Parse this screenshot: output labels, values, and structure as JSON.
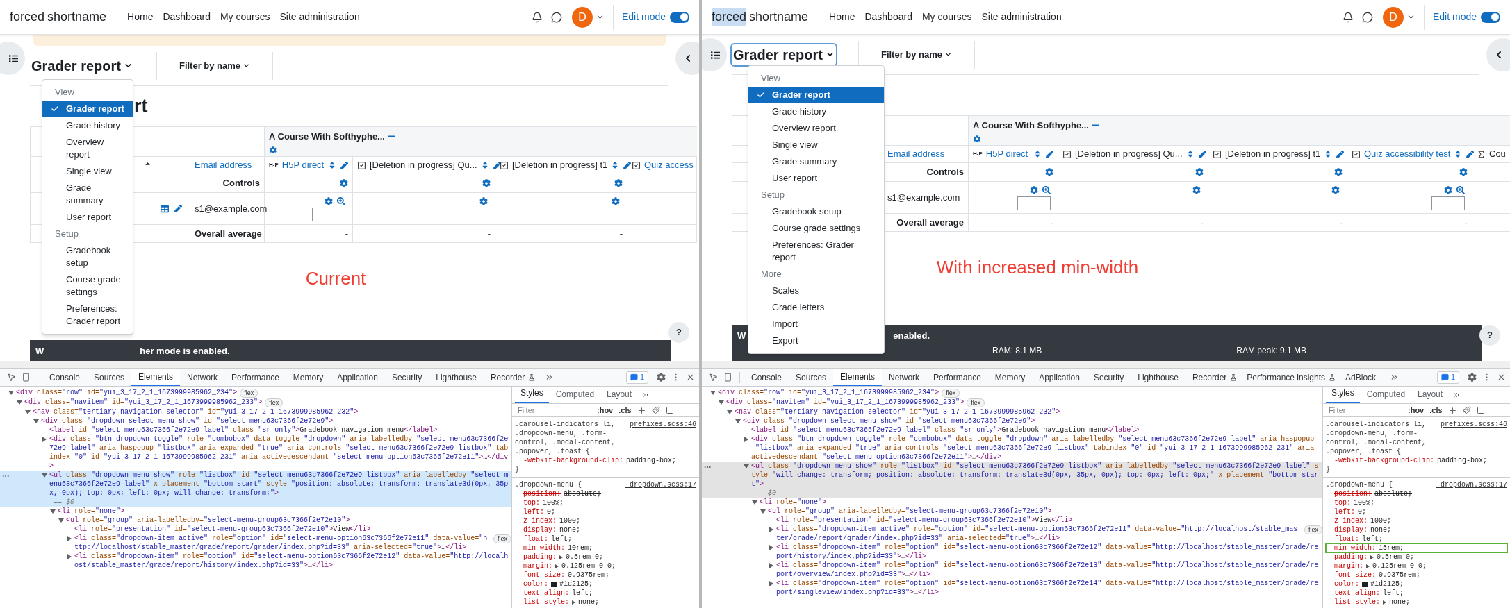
{
  "panes": [
    {
      "navbar": {
        "site_name": [
          {
            "text": "forced",
            "highlighted": false
          },
          {
            "text": "shortname",
            "highlighted": false
          }
        ],
        "links": [
          "Home",
          "Dashboard",
          "My courses",
          "Site administration"
        ],
        "avatar": "D",
        "edit_mode": {
          "label": "Edit mode",
          "on": true
        }
      },
      "alert_bar": true,
      "report_selector": {
        "label": "Grader report",
        "focused": false
      },
      "filter": "Filter by name",
      "heading": "rt",
      "menu": {
        "groups": [
          {
            "heading": "View",
            "items": [
              {
                "label": "Grader report",
                "selected": true
              },
              {
                "label": "Grade history",
                "selected": false
              },
              {
                "label": "Overview report",
                "selected": false
              },
              {
                "label": "Single view",
                "selected": false
              },
              {
                "label": "Grade summary",
                "selected": false
              },
              {
                "label": "User report",
                "selected": false
              }
            ]
          },
          {
            "heading": "Setup",
            "items": [
              {
                "label": "Gradebook setup",
                "selected": false
              },
              {
                "label": "Course grade settings",
                "selected": false
              },
              {
                "label": "Preferences: Grader report",
                "selected": false
              }
            ]
          }
        ]
      },
      "table": {
        "course": "A Course With Softhyphe...",
        "columns": [
          {
            "kind": "sort"
          },
          {
            "kind": "user_actions"
          },
          {
            "kind": "email",
            "header": "Email address",
            "controls": "Controls",
            "student": "s1@example.com",
            "average": "Overall average"
          },
          {
            "kind": "h5p",
            "logo": "H-P",
            "header": "H5P direct",
            "link": true,
            "tools": true,
            "controls_gear": true,
            "student_gear": true,
            "student_entry": true,
            "average": "-"
          },
          {
            "kind": "check",
            "header": "[Deletion in progress] Qu...",
            "link": false,
            "tools": true,
            "controls_gear": true,
            "student_gear": true,
            "student_entry": false,
            "average": "-"
          },
          {
            "kind": "check",
            "header": "[Deletion in progress] t1",
            "link": false,
            "tools": true,
            "controls_gear": true,
            "student_gear": true,
            "student_entry": false,
            "average": "-"
          },
          {
            "kind": "check",
            "header": "Quiz access",
            "link": true,
            "tools": false,
            "controls_gear": false,
            "student_gear": false,
            "student_entry": false
          }
        ]
      },
      "caption": "Current",
      "notice": [
        "W",
        "her mode is enabled."
      ],
      "help": "?",
      "devtools": {
        "focused": true,
        "tabs": [
          {
            "label": "Console",
            "selected": false
          },
          {
            "label": "Sources",
            "selected": false
          },
          {
            "label": "Elements",
            "selected": true
          },
          {
            "label": "Network",
            "selected": false
          },
          {
            "label": "Performance",
            "selected": false
          },
          {
            "label": "Memory",
            "selected": false
          },
          {
            "label": "Application",
            "selected": false
          },
          {
            "label": "Security",
            "selected": false
          },
          {
            "label": "Lighthouse",
            "selected": false
          },
          {
            "label": "Recorder",
            "selected": false,
            "flask": true
          }
        ],
        "issues": "1",
        "tree": [
          {
            "html": "<div class=\"row\" id=\"yui_3_17_2_1_1673999985962_234\">",
            "badge": "flex",
            "expanded": true,
            "selected": false,
            "children": [
              {
                "html": "<div class=\"navitem\" id=\"yui_3_17_2_1_1673999985962_233\">",
                "badge": "flex",
                "expanded": true,
                "selected": false,
                "children": [
                  {
                    "html": "<nav class=\"tertiary-navigation-selector\" id=\"yui_3_17_2_1_1673999985962_232\">",
                    "expanded": true,
                    "selected": false,
                    "children": [
                      {
                        "html": "<div class=\"dropdown select-menu show\" id=\"select-menu63c7366f2e72e9\">",
                        "expanded": true,
                        "selected": false,
                        "children": [
                          {
                            "html": "<label id=\"select-menu63c7366f2e72e9-label\" class=\"sr-only\">Gradebook navigation menu</label>",
                            "selected": false
                          },
                          {
                            "html": "<div class=\"btn dropdown-toggle\" role=\"combobox\" data-toggle=\"dropdown\" aria-labelledby=\"select-menu63c7366f2e72e9-label\" aria-haspopup=\"listbox\" aria-expanded=\"true\" aria-controls=\"select-menu63c7366f2e72e9-listbox\" tabindex=\"0\" id=\"yui_3_17_2_1_1673999985962_231\" aria-activedescendant=\"select-menu-option63c7366f2e72e11\">…</div>",
                            "expanded": false,
                            "selected": false
                          },
                          {
                            "html": "<ul class=\"dropdown-menu show\" role=\"listbox\" id=\"select-menu63c7366f2e72e9-listbox\" aria-labelledby=\"select-menu63c7366f2e72e9-label\" x-placement=\"bottom-start\" style=\"position: absolute; transform: translate3d(0px, 35px, 0px); top: 0px; left: 0px; will-change: transform;\">",
                            "marker": "== $0",
                            "expanded": true,
                            "selected": true,
                            "children": [
                              {
                                "html": "<li role=\"none\">",
                                "expanded": true,
                                "selected": false,
                                "children": [
                                  {
                                    "html": "<ul role=\"group\" aria-labelledby=\"select-menu-group63c7366f2e72e10\">",
                                    "expanded": true,
                                    "selected": false,
                                    "children": [
                                      {
                                        "html": "<li role=\"presentation\" id=\"select-menu-group63c7366f2e72e10\">View</li>",
                                        "selected": false
                                      },
                                      {
                                        "html": "<li class=\"dropdown-item active\" role=\"option\" id=\"select-menu-option63c7366f2e72e11\" data-value=\"http://localhost/stable_master/grade/report/grader/index.php?id=33\" aria-selected=\"true\">…</li>",
                                        "badge": "flex",
                                        "expanded": false,
                                        "selected": false
                                      },
                                      {
                                        "html": "<li class=\"dropdown-item\" role=\"option\" id=\"select-menu-option63c7366f2e72e12\" data-value=\"http://localhost/stable_master/grade/report/history/index.php?id=33\">…</li>",
                                        "expanded": false,
                                        "selected": false
                                      }
                                    ]
                                  }
                                ]
                              }
                            ]
                          }
                        ]
                      }
                    ]
                  }
                ]
              }
            ]
          }
        ],
        "styles": {
          "tabs": [
            {
              "label": "Styles",
              "selected": true
            },
            {
              "label": "Computed",
              "selected": false
            },
            {
              "label": "Layout",
              "selected": false
            }
          ],
          "filter_placeholder": "Filter",
          "hov": ":hov",
          "cls": ".cls",
          "rules": [
            {
              "selector": ".carousel-indicators li, .dropdown-menu, .form-control, .modal-content, .popover, .toast {",
              "source": "prefixes.scss:46",
              "close": "}",
              "declarations": [
                {
                  "property": "-webkit-background-clip:",
                  "value": "padding-box;",
                  "struck": false
                }
              ]
            },
            {
              "selector": ".dropdown-menu {",
              "source": "_dropdown.scss:17",
              "declarations": [
                {
                  "property": "position:",
                  "value": "absolute;",
                  "struck": true
                },
                {
                  "property": "top:",
                  "value": "100%;",
                  "struck": true
                },
                {
                  "property": "left:",
                  "value": "0;",
                  "struck": true
                },
                {
                  "property": "z-index:",
                  "value": "1000;",
                  "struck": false
                },
                {
                  "property": "display:",
                  "value": "none;",
                  "struck": true
                },
                {
                  "property": "float:",
                  "value": "left;",
                  "struck": false
                },
                {
                  "property": "min-width:",
                  "value": "10rem;",
                  "struck": false
                },
                {
                  "property": "padding:",
                  "value": "0.5rem 0;",
                  "struck": false,
                  "expandable": true
                },
                {
                  "property": "margin:",
                  "value": "0.125rem 0 0;",
                  "struck": false,
                  "expandable": true
                },
                {
                  "property": "font-size:",
                  "value": "0.9375rem;",
                  "struck": false
                },
                {
                  "property": "color:",
                  "value": "#1d2125;",
                  "struck": false,
                  "color": "#1d2125"
                },
                {
                  "property": "text-align:",
                  "value": "left;",
                  "struck": false
                },
                {
                  "property": "list-style:",
                  "value": "none;",
                  "struck": false,
                  "expandable": true
                }
              ]
            }
          ]
        }
      }
    },
    {
      "navbar": {
        "site_name": [
          {
            "text": "forced",
            "highlighted": true
          },
          {
            "text": "shortname",
            "highlighted": false
          }
        ],
        "links": [
          "Home",
          "Dashboard",
          "My courses",
          "Site administration"
        ],
        "avatar": "D",
        "edit_mode": {
          "label": "Edit mode",
          "on": true
        }
      },
      "alert_bar": false,
      "report_selector": {
        "label": "Grader report",
        "focused": true
      },
      "filter": "Filter by name",
      "menu": {
        "groups": [
          {
            "heading": "View",
            "items": [
              {
                "label": "Grader report",
                "selected": true
              },
              {
                "label": "Grade history",
                "selected": false
              },
              {
                "label": "Overview report",
                "selected": false
              },
              {
                "label": "Single view",
                "selected": false
              },
              {
                "label": "Grade summary",
                "selected": false
              },
              {
                "label": "User report",
                "selected": false
              }
            ]
          },
          {
            "heading": "Setup",
            "items": [
              {
                "label": "Gradebook setup",
                "selected": false
              },
              {
                "label": "Course grade settings",
                "selected": false
              },
              {
                "label": "Preferences: Grader report",
                "selected": false
              }
            ]
          },
          {
            "heading": "More",
            "items": [
              {
                "label": "Scales",
                "selected": false
              },
              {
                "label": "Grade letters",
                "selected": false
              },
              {
                "label": "Import",
                "selected": false
              },
              {
                "label": "Export",
                "selected": false
              }
            ]
          }
        ]
      },
      "table": {
        "course": "A Course With Softhyphe...",
        "columns": [
          {
            "kind": "spacer"
          },
          {
            "kind": "email",
            "header": "Email address",
            "controls": "Controls",
            "student": "s1@example.com",
            "average": "Overall average"
          },
          {
            "kind": "h5p",
            "logo": "H-P",
            "header": "H5P direct",
            "link": true,
            "tools": true,
            "controls_gear": true,
            "student_gear": true,
            "student_entry": true,
            "average": "-"
          },
          {
            "kind": "check",
            "header": "[Deletion in progress] Qu...",
            "link": false,
            "tools": true,
            "controls_gear": true,
            "student_gear": true,
            "student_entry": false,
            "average": "-"
          },
          {
            "kind": "check",
            "header": "[Deletion in progress] t1",
            "link": false,
            "tools": true,
            "controls_gear": true,
            "student_gear": true,
            "student_entry": false,
            "average": "-"
          },
          {
            "kind": "check",
            "header": "Quiz accessibility test",
            "link": true,
            "tools": true,
            "controls_gear": true,
            "student_gear": true,
            "student_entry": true,
            "average": "-"
          },
          {
            "kind": "sigma",
            "header": "Cou",
            "link": false,
            "tools": false,
            "controls_gear": false,
            "student_gear": false,
            "student_entry": false
          }
        ]
      },
      "caption": "With increased min-width",
      "notice": [
        "W",
        "enabled."
      ],
      "footer": [
        "RAM: 8.1 MB",
        "RAM peak: 9.1 MB"
      ],
      "help": "?",
      "devtools": {
        "focused": false,
        "tabs": [
          {
            "label": "Console",
            "selected": false
          },
          {
            "label": "Sources",
            "selected": false
          },
          {
            "label": "Elements",
            "selected": true
          },
          {
            "label": "Network",
            "selected": false
          },
          {
            "label": "Performance",
            "selected": false
          },
          {
            "label": "Memory",
            "selected": false
          },
          {
            "label": "Application",
            "selected": false
          },
          {
            "label": "Security",
            "selected": false
          },
          {
            "label": "Lighthouse",
            "selected": false
          },
          {
            "label": "Recorder",
            "selected": false,
            "flask": true
          },
          {
            "label": "Performance insights",
            "selected": false,
            "flask": true
          },
          {
            "label": "AdBlock",
            "selected": false
          }
        ],
        "issues": "1",
        "tree": [
          {
            "html": "<div class=\"row\" id=\"yui_3_17_2_1_1673999985962_234\">",
            "badge": "flex",
            "expanded": true,
            "selected": false,
            "children": [
              {
                "html": "<div class=\"navitem\" id=\"yui_3_17_2_1_1673999985962_233\">",
                "badge": "flex",
                "expanded": true,
                "selected": false,
                "children": [
                  {
                    "html": "<nav class=\"tertiary-navigation-selector\" id=\"yui_3_17_2_1_1673999985962_232\">",
                    "expanded": true,
                    "selected": false,
                    "children": [
                      {
                        "html": "<div class=\"dropdown select-menu show\" id=\"select-menu63c7366f2e72e9\">",
                        "expanded": true,
                        "selected": false,
                        "children": [
                          {
                            "html": "<label id=\"select-menu63c7366f2e72e9-label\" class=\"sr-only\">Gradebook navigation menu</label>",
                            "selected": false
                          },
                          {
                            "html": "<div class=\"btn dropdown-toggle\" role=\"combobox\" data-toggle=\"dropdown\" aria-labelledby=\"select-menu63c7366f2e72e9-label\" aria-haspopup=\"listbox\" aria-expanded=\"true\" aria-controls=\"select-menu63c7366f2e72e9-listbox\" tabindex=\"0\" id=\"yui_3_17_2_1_1673999985962_231\" aria-activedescendant=\"select-menu-option63c7366f2e72e11\">…</div>",
                            "expanded": false,
                            "selected": false
                          },
                          {
                            "html": "<ul class=\"dropdown-menu show\" role=\"listbox\" id=\"select-menu63c7366f2e72e9-listbox\" aria-labelledby=\"select-menu63c7366f2e72e9-label\" style=\"will-change: transform; position: absolute; transform: translate3d(0px, 35px, 0px); top: 0px; left: 0px;\" x-placement=\"bottom-start\">",
                            "marker": "== $0",
                            "expanded": true,
                            "selected": true,
                            "children": [
                              {
                                "html": "<li role=\"none\">",
                                "expanded": true,
                                "selected": false,
                                "children": [
                                  {
                                    "html": "<ul role=\"group\" aria-labelledby=\"select-menu-group63c7366f2e72e10\">",
                                    "expanded": true,
                                    "selected": false,
                                    "children": [
                                      {
                                        "html": "<li role=\"presentation\" id=\"select-menu-group63c7366f2e72e10\">View</li>",
                                        "selected": false
                                      },
                                      {
                                        "html": "<li class=\"dropdown-item active\" role=\"option\" id=\"select-menu-option63c7366f2e72e11\" data-value=\"http://localhost/stable_master/grade/report/grader/index.php?id=33\" aria-selected=\"true\">…</li>",
                                        "badge": "flex",
                                        "expanded": false,
                                        "selected": false
                                      },
                                      {
                                        "html": "<li class=\"dropdown-item\" role=\"option\" id=\"select-menu-option63c7366f2e72e12\" data-value=\"http://localhost/stable_master/grade/report/history/index.php?id=33\">…</li>",
                                        "expanded": false,
                                        "selected": false
                                      },
                                      {
                                        "html": "<li class=\"dropdown-item\" role=\"option\" id=\"select-menu-option63c7366f2e72e13\" data-value=\"http://localhost/stable_master/grade/report/overview/index.php?id=33\">…</li>",
                                        "expanded": false,
                                        "selected": false
                                      },
                                      {
                                        "html": "<li class=\"dropdown-item\" role=\"option\" id=\"select-menu-option63c7366f2e72e14\" data-value=\"http://localhost/stable_master/grade/report/singleview/index.php?id=33\">…</li>",
                                        "expanded": false,
                                        "selected": false
                                      }
                                    ]
                                  }
                                ]
                              }
                            ]
                          }
                        ]
                      }
                    ]
                  }
                ]
              }
            ]
          }
        ],
        "styles": {
          "tabs": [
            {
              "label": "Styles",
              "selected": true
            },
            {
              "label": "Computed",
              "selected": false
            },
            {
              "label": "Layout",
              "selected": false
            }
          ],
          "filter_placeholder": "Filter",
          "hov": ":hov",
          "cls": ".cls",
          "rules": [
            {
              "selector": ".carousel-indicators li, .dropdown-menu, .form-control, .modal-content, .popover, .toast {",
              "source": "prefixes.scss:46",
              "close": "}",
              "declarations": [
                {
                  "property": "-webkit-background-clip:",
                  "value": "padding-box;",
                  "struck": false
                }
              ]
            },
            {
              "selector": ".dropdown-menu {",
              "source": "_dropdown.scss:17",
              "declarations": [
                {
                  "property": "position:",
                  "value": "absolute;",
                  "struck": true
                },
                {
                  "property": "top:",
                  "value": "100%;",
                  "struck": true
                },
                {
                  "property": "left:",
                  "value": "0;",
                  "struck": true
                },
                {
                  "property": "z-index:",
                  "value": "1000;",
                  "struck": false
                },
                {
                  "property": "display:",
                  "value": "none;",
                  "struck": true
                },
                {
                  "property": "float:",
                  "value": "left;",
                  "struck": false
                },
                {
                  "property": "min-width:",
                  "value": "15rem;",
                  "struck": false,
                  "highlighted": true
                },
                {
                  "property": "padding:",
                  "value": "0.5rem 0;",
                  "struck": false,
                  "expandable": true
                },
                {
                  "property": "margin:",
                  "value": "0.125rem 0 0;",
                  "struck": false,
                  "expandable": true
                },
                {
                  "property": "font-size:",
                  "value": "0.9375rem;",
                  "struck": false
                },
                {
                  "property": "color:",
                  "value": "#1d2125;",
                  "struck": false,
                  "color": "#1d2125"
                },
                {
                  "property": "text-align:",
                  "value": "left;",
                  "struck": false
                },
                {
                  "property": "list-style:",
                  "value": "none;",
                  "struck": false,
                  "expandable": true
                }
              ]
            }
          ]
        }
      }
    }
  ]
}
